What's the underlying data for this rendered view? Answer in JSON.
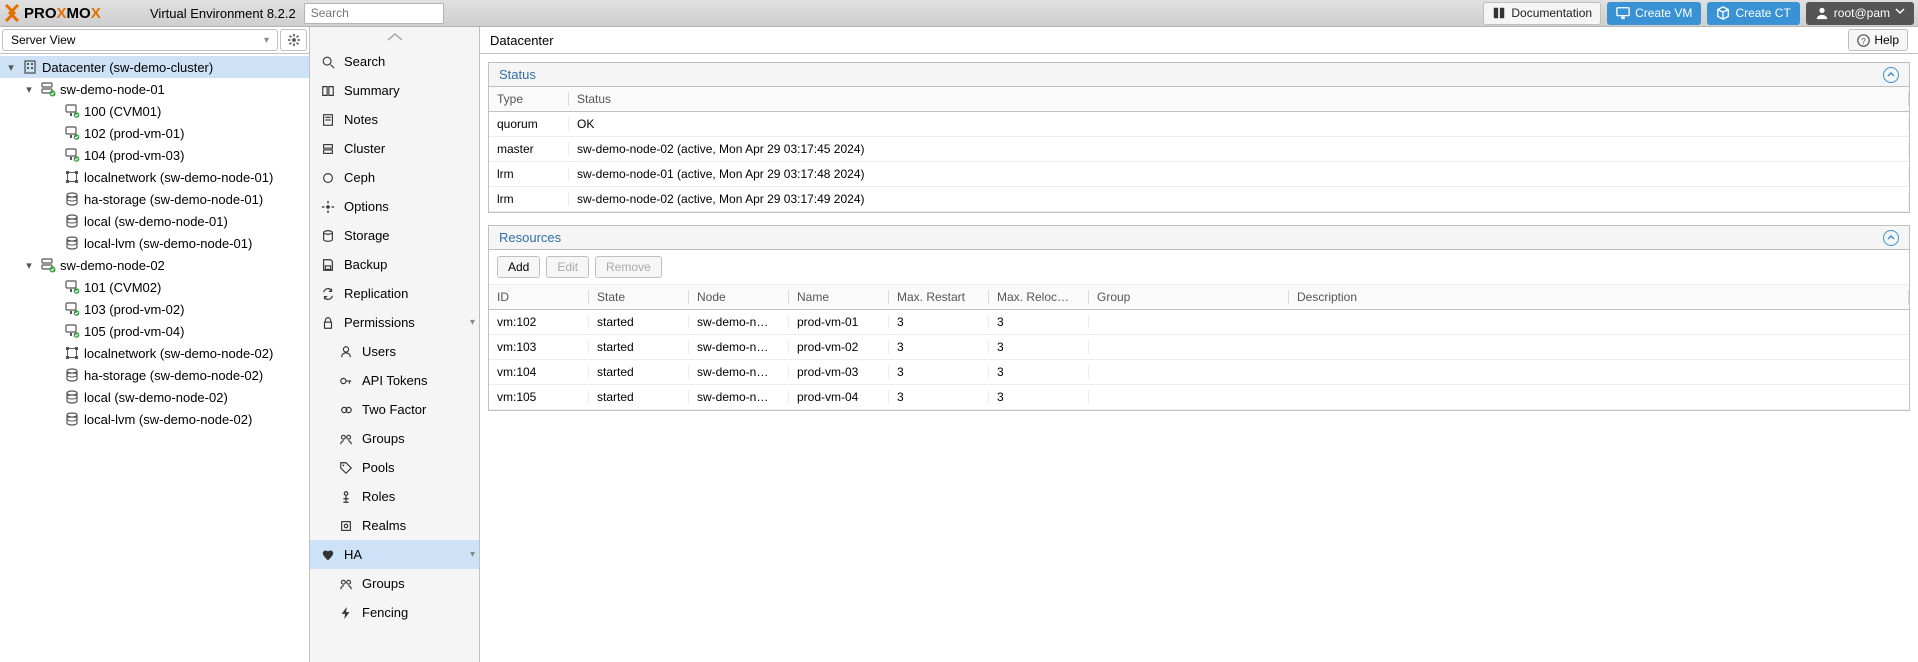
{
  "topbar": {
    "title": "Virtual Environment 8.2.2",
    "search_placeholder": "Search",
    "doc_label": "Documentation",
    "create_vm_label": "Create VM",
    "create_ct_label": "Create CT",
    "user_label": "root@pam"
  },
  "tree": {
    "view_label": "Server View",
    "nodes": [
      {
        "depth": 0,
        "icon": "building",
        "label": "Datacenter (sw-demo-cluster)",
        "selected": true,
        "toggle": "▾"
      },
      {
        "depth": 1,
        "icon": "server-ok",
        "label": "sw-demo-node-01",
        "toggle": "▾"
      },
      {
        "depth": 2,
        "icon": "monitor-ok",
        "label": "100 (CVM01)"
      },
      {
        "depth": 2,
        "icon": "monitor-ok",
        "label": "102 (prod-vm-01)"
      },
      {
        "depth": 2,
        "icon": "monitor-ok",
        "label": "104 (prod-vm-03)"
      },
      {
        "depth": 2,
        "icon": "network",
        "label": "localnetwork (sw-demo-node-01)"
      },
      {
        "depth": 2,
        "icon": "storage",
        "label": "ha-storage (sw-demo-node-01)"
      },
      {
        "depth": 2,
        "icon": "storage",
        "label": "local (sw-demo-node-01)"
      },
      {
        "depth": 2,
        "icon": "storage",
        "label": "local-lvm (sw-demo-node-01)"
      },
      {
        "depth": 1,
        "icon": "server-ok",
        "label": "sw-demo-node-02",
        "toggle": "▾"
      },
      {
        "depth": 2,
        "icon": "monitor-ok",
        "label": "101 (CVM02)"
      },
      {
        "depth": 2,
        "icon": "monitor-ok",
        "label": "103 (prod-vm-02)"
      },
      {
        "depth": 2,
        "icon": "monitor-ok",
        "label": "105 (prod-vm-04)"
      },
      {
        "depth": 2,
        "icon": "network",
        "label": "localnetwork (sw-demo-node-02)"
      },
      {
        "depth": 2,
        "icon": "storage",
        "label": "ha-storage (sw-demo-node-02)"
      },
      {
        "depth": 2,
        "icon": "storage",
        "label": "local (sw-demo-node-02)"
      },
      {
        "depth": 2,
        "icon": "storage",
        "label": "local-lvm (sw-demo-node-02)"
      }
    ]
  },
  "menu": [
    {
      "icon": "search",
      "label": "Search"
    },
    {
      "icon": "book",
      "label": "Summary"
    },
    {
      "icon": "note",
      "label": "Notes"
    },
    {
      "icon": "cluster",
      "label": "Cluster"
    },
    {
      "icon": "ceph",
      "label": "Ceph"
    },
    {
      "icon": "gear",
      "label": "Options"
    },
    {
      "icon": "db",
      "label": "Storage"
    },
    {
      "icon": "save",
      "label": "Backup"
    },
    {
      "icon": "repl",
      "label": "Replication"
    },
    {
      "icon": "lock",
      "label": "Permissions",
      "expandable": true
    },
    {
      "icon": "user",
      "label": "Users",
      "sub": true
    },
    {
      "icon": "key",
      "label": "API Tokens",
      "sub": true
    },
    {
      "icon": "twofa",
      "label": "Two Factor",
      "sub": true
    },
    {
      "icon": "group",
      "label": "Groups",
      "sub": true
    },
    {
      "icon": "tag",
      "label": "Pools",
      "sub": true
    },
    {
      "icon": "role",
      "label": "Roles",
      "sub": true
    },
    {
      "icon": "realm",
      "label": "Realms",
      "sub": true
    },
    {
      "icon": "heart",
      "label": "HA",
      "selected": true,
      "expandable": true
    },
    {
      "icon": "group",
      "label": "Groups",
      "sub": true
    },
    {
      "icon": "bolt",
      "label": "Fencing",
      "sub": true
    }
  ],
  "breadcrumb": "Datacenter",
  "help_label": "Help",
  "status_panel": {
    "title": "Status",
    "headers": {
      "type": "Type",
      "status": "Status"
    },
    "rows": [
      {
        "type": "quorum",
        "status": "OK"
      },
      {
        "type": "master",
        "status": "sw-demo-node-02 (active, Mon Apr 29 03:17:45 2024)"
      },
      {
        "type": "lrm",
        "status": "sw-demo-node-01 (active, Mon Apr 29 03:17:48 2024)"
      },
      {
        "type": "lrm",
        "status": "sw-demo-node-02 (active, Mon Apr 29 03:17:49 2024)"
      }
    ]
  },
  "resources_panel": {
    "title": "Resources",
    "toolbar": {
      "add": "Add",
      "edit": "Edit",
      "remove": "Remove"
    },
    "headers": {
      "id": "ID",
      "state": "State",
      "node": "Node",
      "name": "Name",
      "max_restart": "Max. Restart",
      "max_reloc": "Max. Reloc…",
      "group": "Group",
      "desc": "Description"
    },
    "rows": [
      {
        "id": "vm:102",
        "state": "started",
        "node": "sw-demo-n…",
        "name": "prod-vm-01",
        "max_restart": "3",
        "max_reloc": "3",
        "group": "",
        "desc": ""
      },
      {
        "id": "vm:103",
        "state": "started",
        "node": "sw-demo-n…",
        "name": "prod-vm-02",
        "max_restart": "3",
        "max_reloc": "3",
        "group": "",
        "desc": ""
      },
      {
        "id": "vm:104",
        "state": "started",
        "node": "sw-demo-n…",
        "name": "prod-vm-03",
        "max_restart": "3",
        "max_reloc": "3",
        "group": "",
        "desc": ""
      },
      {
        "id": "vm:105",
        "state": "started",
        "node": "sw-demo-n…",
        "name": "prod-vm-04",
        "max_restart": "3",
        "max_reloc": "3",
        "group": "",
        "desc": ""
      }
    ]
  }
}
